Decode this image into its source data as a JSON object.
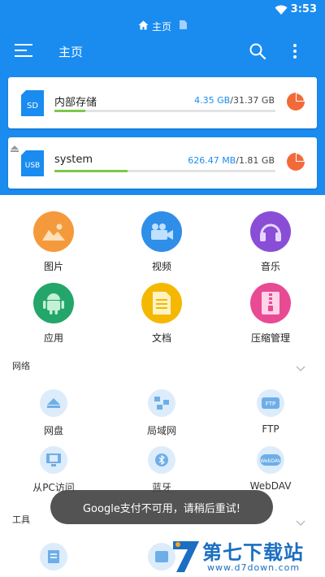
{
  "status_bar": {
    "time": "3:53",
    "wifi_icon": "wifi-icon"
  },
  "breadcrumb": {
    "home_label": "主页",
    "home_icon": "home-icon",
    "doc_icon": "document-icon"
  },
  "app_bar": {
    "title": "主页",
    "menu_icon": "hamburger-menu-icon",
    "search_icon": "search-icon",
    "more_icon": "more-vert-icon"
  },
  "storage": [
    {
      "name": "内部存储",
      "used": "4.35 GB",
      "total": "/31.37 GB",
      "badge": "SD",
      "usage_fraction": 0.14
    },
    {
      "name": "system",
      "used": "626.47 MB",
      "total": "/1.81 GB",
      "badge": "USB",
      "usage_fraction": 0.33
    }
  ],
  "categories": [
    {
      "label": "图片",
      "color": "#f59a3c",
      "icon": "image-icon"
    },
    {
      "label": "视频",
      "color": "#2f8ee8",
      "icon": "video-icon"
    },
    {
      "label": "音乐",
      "color": "#8a4ed6",
      "icon": "headphones-icon"
    },
    {
      "label": "应用",
      "color": "#24a66b",
      "icon": "android-icon"
    },
    {
      "label": "文档",
      "color": "#f5b800",
      "icon": "document-icon"
    },
    {
      "label": "压缩管理",
      "color": "#e84a93",
      "icon": "archive-icon"
    }
  ],
  "sections": {
    "network": {
      "title": "网络",
      "items": [
        {
          "label": "网盘",
          "icon": "cloud-drive-icon"
        },
        {
          "label": "局域网",
          "icon": "lan-icon"
        },
        {
          "label": "FTP",
          "icon": "ftp-icon"
        },
        {
          "label": "从PC访问",
          "icon": "pc-access-icon"
        },
        {
          "label": "蓝牙",
          "icon": "bluetooth-icon"
        },
        {
          "label": "WebDAV",
          "icon": "webdav-icon"
        }
      ]
    },
    "tools": {
      "title": "工具"
    }
  },
  "toast": {
    "message": "Google支付不可用，请稍后重试!"
  },
  "watermark": {
    "title": "第七下载站",
    "url": "www.d7down.com"
  }
}
